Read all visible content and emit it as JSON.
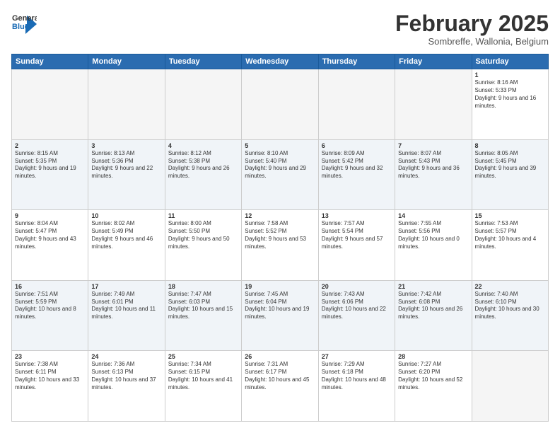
{
  "header": {
    "logo_line1": "General",
    "logo_line2": "Blue",
    "month": "February 2025",
    "location": "Sombreffe, Wallonia, Belgium"
  },
  "days_of_week": [
    "Sunday",
    "Monday",
    "Tuesday",
    "Wednesday",
    "Thursday",
    "Friday",
    "Saturday"
  ],
  "weeks": [
    {
      "days": [
        {
          "num": "",
          "info": "",
          "empty": true
        },
        {
          "num": "",
          "info": "",
          "empty": true
        },
        {
          "num": "",
          "info": "",
          "empty": true
        },
        {
          "num": "",
          "info": "",
          "empty": true
        },
        {
          "num": "",
          "info": "",
          "empty": true
        },
        {
          "num": "",
          "info": "",
          "empty": true
        },
        {
          "num": "1",
          "info": "Sunrise: 8:16 AM\nSunset: 5:33 PM\nDaylight: 9 hours and 16 minutes.",
          "empty": false
        }
      ]
    },
    {
      "days": [
        {
          "num": "2",
          "info": "Sunrise: 8:15 AM\nSunset: 5:35 PM\nDaylight: 9 hours and 19 minutes.",
          "empty": false
        },
        {
          "num": "3",
          "info": "Sunrise: 8:13 AM\nSunset: 5:36 PM\nDaylight: 9 hours and 22 minutes.",
          "empty": false
        },
        {
          "num": "4",
          "info": "Sunrise: 8:12 AM\nSunset: 5:38 PM\nDaylight: 9 hours and 26 minutes.",
          "empty": false
        },
        {
          "num": "5",
          "info": "Sunrise: 8:10 AM\nSunset: 5:40 PM\nDaylight: 9 hours and 29 minutes.",
          "empty": false
        },
        {
          "num": "6",
          "info": "Sunrise: 8:09 AM\nSunset: 5:42 PM\nDaylight: 9 hours and 32 minutes.",
          "empty": false
        },
        {
          "num": "7",
          "info": "Sunrise: 8:07 AM\nSunset: 5:43 PM\nDaylight: 9 hours and 36 minutes.",
          "empty": false
        },
        {
          "num": "8",
          "info": "Sunrise: 8:05 AM\nSunset: 5:45 PM\nDaylight: 9 hours and 39 minutes.",
          "empty": false
        }
      ]
    },
    {
      "days": [
        {
          "num": "9",
          "info": "Sunrise: 8:04 AM\nSunset: 5:47 PM\nDaylight: 9 hours and 43 minutes.",
          "empty": false
        },
        {
          "num": "10",
          "info": "Sunrise: 8:02 AM\nSunset: 5:49 PM\nDaylight: 9 hours and 46 minutes.",
          "empty": false
        },
        {
          "num": "11",
          "info": "Sunrise: 8:00 AM\nSunset: 5:50 PM\nDaylight: 9 hours and 50 minutes.",
          "empty": false
        },
        {
          "num": "12",
          "info": "Sunrise: 7:58 AM\nSunset: 5:52 PM\nDaylight: 9 hours and 53 minutes.",
          "empty": false
        },
        {
          "num": "13",
          "info": "Sunrise: 7:57 AM\nSunset: 5:54 PM\nDaylight: 9 hours and 57 minutes.",
          "empty": false
        },
        {
          "num": "14",
          "info": "Sunrise: 7:55 AM\nSunset: 5:56 PM\nDaylight: 10 hours and 0 minutes.",
          "empty": false
        },
        {
          "num": "15",
          "info": "Sunrise: 7:53 AM\nSunset: 5:57 PM\nDaylight: 10 hours and 4 minutes.",
          "empty": false
        }
      ]
    },
    {
      "days": [
        {
          "num": "16",
          "info": "Sunrise: 7:51 AM\nSunset: 5:59 PM\nDaylight: 10 hours and 8 minutes.",
          "empty": false
        },
        {
          "num": "17",
          "info": "Sunrise: 7:49 AM\nSunset: 6:01 PM\nDaylight: 10 hours and 11 minutes.",
          "empty": false
        },
        {
          "num": "18",
          "info": "Sunrise: 7:47 AM\nSunset: 6:03 PM\nDaylight: 10 hours and 15 minutes.",
          "empty": false
        },
        {
          "num": "19",
          "info": "Sunrise: 7:45 AM\nSunset: 6:04 PM\nDaylight: 10 hours and 19 minutes.",
          "empty": false
        },
        {
          "num": "20",
          "info": "Sunrise: 7:43 AM\nSunset: 6:06 PM\nDaylight: 10 hours and 22 minutes.",
          "empty": false
        },
        {
          "num": "21",
          "info": "Sunrise: 7:42 AM\nSunset: 6:08 PM\nDaylight: 10 hours and 26 minutes.",
          "empty": false
        },
        {
          "num": "22",
          "info": "Sunrise: 7:40 AM\nSunset: 6:10 PM\nDaylight: 10 hours and 30 minutes.",
          "empty": false
        }
      ]
    },
    {
      "days": [
        {
          "num": "23",
          "info": "Sunrise: 7:38 AM\nSunset: 6:11 PM\nDaylight: 10 hours and 33 minutes.",
          "empty": false
        },
        {
          "num": "24",
          "info": "Sunrise: 7:36 AM\nSunset: 6:13 PM\nDaylight: 10 hours and 37 minutes.",
          "empty": false
        },
        {
          "num": "25",
          "info": "Sunrise: 7:34 AM\nSunset: 6:15 PM\nDaylight: 10 hours and 41 minutes.",
          "empty": false
        },
        {
          "num": "26",
          "info": "Sunrise: 7:31 AM\nSunset: 6:17 PM\nDaylight: 10 hours and 45 minutes.",
          "empty": false
        },
        {
          "num": "27",
          "info": "Sunrise: 7:29 AM\nSunset: 6:18 PM\nDaylight: 10 hours and 48 minutes.",
          "empty": false
        },
        {
          "num": "28",
          "info": "Sunrise: 7:27 AM\nSunset: 6:20 PM\nDaylight: 10 hours and 52 minutes.",
          "empty": false
        },
        {
          "num": "",
          "info": "",
          "empty": true
        }
      ]
    }
  ]
}
